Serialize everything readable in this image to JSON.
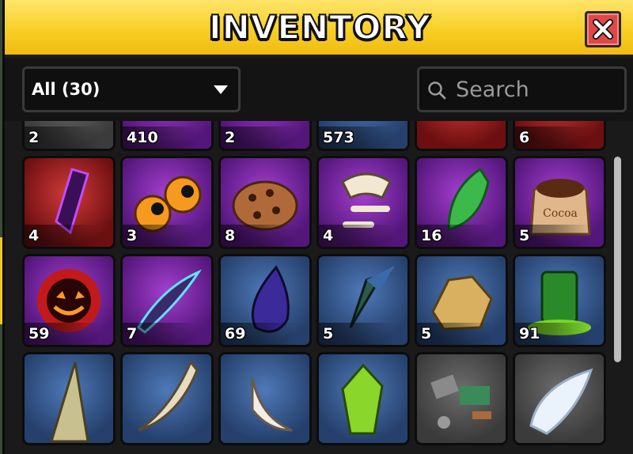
{
  "window": {
    "title": "INVENTORY",
    "close_icon": "close-x-icon"
  },
  "toolbar": {
    "filter_label": "All (30)",
    "filter_icon": "dropdown-caret-icon",
    "search_placeholder": "Search",
    "search_value": "",
    "search_icon": "magnifier-icon"
  },
  "colors": {
    "title_bar": "#f7cf25",
    "close_button": "#e04848",
    "rarity_common": "#5a5a5a",
    "rarity_uncommon": "#2f5590",
    "rarity_rare": "#7b2ba6",
    "rarity_legendary": "#9a1a1a"
  },
  "items": [
    {
      "row": 0,
      "col": 0,
      "rarity": "grey",
      "icon": "wooden-planks-icon",
      "qty": "2"
    },
    {
      "row": 0,
      "col": 1,
      "rarity": "purple",
      "icon": "golden-sun-medallion-icon",
      "qty": "410"
    },
    {
      "row": 0,
      "col": 2,
      "rarity": "purple",
      "icon": "candy-and-chocolate-bar-icon",
      "qty": "2"
    },
    {
      "row": 0,
      "col": 3,
      "rarity": "blue",
      "icon": "bones-icon",
      "qty": "573"
    },
    {
      "row": 0,
      "col": 4,
      "rarity": "red",
      "icon": "metal-canister-icon",
      "qty": ""
    },
    {
      "row": 0,
      "col": 5,
      "rarity": "red",
      "icon": "red-crystal-icon",
      "qty": "6"
    },
    {
      "row": 1,
      "col": 0,
      "rarity": "red",
      "icon": "dark-purple-crystal-icon",
      "qty": "4"
    },
    {
      "row": 1,
      "col": 1,
      "rarity": "purple",
      "icon": "orange-eyeballs-icon",
      "qty": "3"
    },
    {
      "row": 1,
      "col": 2,
      "rarity": "purple",
      "icon": "cookie-icon",
      "qty": "8"
    },
    {
      "row": 1,
      "col": 3,
      "rarity": "purple",
      "icon": "dinosaur-fossil-icon",
      "qty": "4"
    },
    {
      "row": 1,
      "col": 4,
      "rarity": "purple",
      "icon": "green-leaf-icon",
      "qty": "16"
    },
    {
      "row": 1,
      "col": 5,
      "rarity": "purple",
      "icon": "cocoa-sack-icon",
      "qty": "5"
    },
    {
      "row": 2,
      "col": 0,
      "rarity": "purple",
      "icon": "jack-o-lantern-flame-icon",
      "qty": "59"
    },
    {
      "row": 2,
      "col": 1,
      "rarity": "purple",
      "icon": "electric-feather-icon",
      "qty": "7"
    },
    {
      "row": 2,
      "col": 2,
      "rarity": "blue",
      "icon": "dark-ink-drop-icon",
      "qty": "69"
    },
    {
      "row": 2,
      "col": 3,
      "rarity": "blue",
      "icon": "fish-tail-icon",
      "qty": "5"
    },
    {
      "row": 2,
      "col": 4,
      "rarity": "blue",
      "icon": "gold-ore-icon",
      "qty": "5"
    },
    {
      "row": 2,
      "col": 5,
      "rarity": "blue",
      "icon": "green-slime-jar-icon",
      "qty": "91"
    },
    {
      "row": 3,
      "col": 0,
      "rarity": "blue",
      "icon": "spiked-horn-icon",
      "qty": ""
    },
    {
      "row": 3,
      "col": 1,
      "rarity": "blue",
      "icon": "ivory-tusk-icon",
      "qty": ""
    },
    {
      "row": 3,
      "col": 2,
      "rarity": "blue",
      "icon": "white-claw-icon",
      "qty": ""
    },
    {
      "row": 3,
      "col": 3,
      "rarity": "blue",
      "icon": "green-crystal-icon",
      "qty": ""
    },
    {
      "row": 3,
      "col": 4,
      "rarity": "grey",
      "icon": "scrap-parts-icon",
      "qty": ""
    },
    {
      "row": 3,
      "col": 5,
      "rarity": "grey",
      "icon": "angel-wing-icon",
      "qty": ""
    }
  ]
}
